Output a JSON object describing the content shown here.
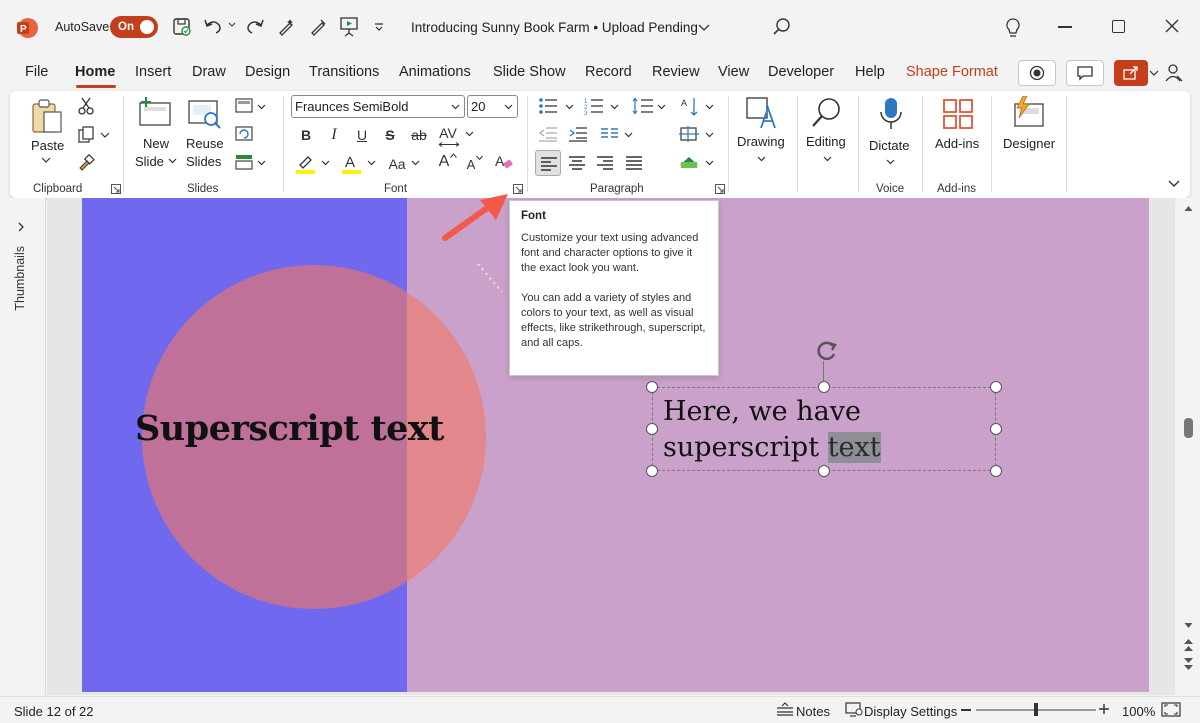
{
  "app": {
    "autosave_label": "AutoSave",
    "autosave_state": "On",
    "doc_title": "Introducing Sunny Book Farm • Upload Pending"
  },
  "menu": {
    "tabs": [
      "File",
      "Home",
      "Insert",
      "Draw",
      "Design",
      "Transitions",
      "Animations",
      "Slide Show",
      "Record",
      "Review",
      "View",
      "Developer",
      "Help",
      "Shape Format"
    ],
    "active": "Home"
  },
  "ribbon": {
    "clipboard": {
      "paste": "Paste",
      "group": "Clipboard"
    },
    "slides": {
      "new_slide_1": "New",
      "new_slide_2": "Slide",
      "reuse_1": "Reuse",
      "reuse_2": "Slides",
      "group": "Slides"
    },
    "font": {
      "family": "Fraunces SemiBold",
      "size": "20",
      "bold": "B",
      "italic": "I",
      "underline": "U",
      "strike_s": "S",
      "strike_ab": "ab",
      "spacing": "AV",
      "case": "Aa",
      "grow": "A",
      "shrink": "A",
      "group": "Font"
    },
    "paragraph": {
      "group": "Paragraph"
    },
    "drawing": {
      "label": "Drawing"
    },
    "editing": {
      "label": "Editing"
    },
    "voice": {
      "dictate": "Dictate",
      "group": "Voice"
    },
    "addins": {
      "label": "Add-ins",
      "group": "Add-ins"
    },
    "designer": {
      "label": "Designer"
    }
  },
  "tooltip": {
    "title": "Font",
    "p1": "Customize your text using advanced font and character options to give it the exact look you want.",
    "p2": "You can add a variety of styles and colors to your text, as well as visual effects, like strikethrough, superscript, and all caps."
  },
  "left_pane": {
    "label": "Thumbnails"
  },
  "slide": {
    "heading": "Superscript text",
    "textbox_line1": "Here, we have",
    "textbox_line2_plain": "superscript ",
    "textbox_line2_selected": "text"
  },
  "status": {
    "slide": "Slide 12 of 22",
    "notes": "Notes",
    "display_settings": "Display Settings",
    "zoom": "100%",
    "zoom_fraction": 0.5
  },
  "colors": {
    "accent": "#c43e1c",
    "slide_blue": "#7068ee",
    "slide_purple": "#caa1ca",
    "circle": "#f07864",
    "arrow": "#f2594b"
  }
}
